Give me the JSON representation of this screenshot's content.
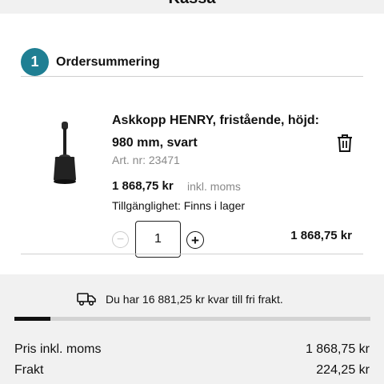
{
  "page": {
    "title": "Kassa"
  },
  "order_summary": {
    "step_number": "1",
    "title": "Ordersummering"
  },
  "product": {
    "name": "Askkopp HENRY, fristående, höjd: 980 mm, svart",
    "article": "Art. nr: 23471",
    "price": "1 868,75 kr",
    "price_note": "inkl. moms",
    "availability": "Tillgänglighet: Finns i lager",
    "quantity": "1",
    "line_total": "1 868,75 kr",
    "image_icon": "ashtray-stand-icon"
  },
  "free_shipping": {
    "message": "Du har 16 881,25 kr kvar till fri frakt.",
    "progress_fraction": 0.1
  },
  "totals": {
    "rows": [
      {
        "label": "Pris inkl. moms",
        "value": "1 868,75 kr"
      },
      {
        "label": "Frakt",
        "value": "224,25 kr"
      }
    ]
  },
  "colors": {
    "accent": "#1f7f93",
    "progress_fill": "#111111",
    "progress_track": "#d3d3d3"
  }
}
